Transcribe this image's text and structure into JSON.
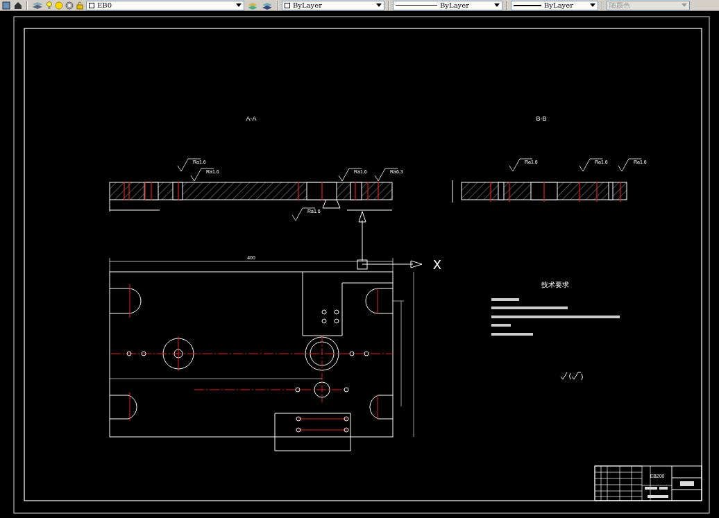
{
  "toolbar": {
    "layer": {
      "name": "EB0"
    },
    "color": {
      "label": "ByLayer"
    },
    "linetype": {
      "label": "ByLayer"
    },
    "lineweight": {
      "label": "ByLayer"
    },
    "plot_style": {
      "label": "随颜色",
      "disabled": true
    }
  },
  "drawing": {
    "section_labels": [
      "A-A",
      "B-B"
    ],
    "surface_finish_labels": [
      "Ra1.6",
      "Ra1.6",
      "Ra1.6",
      "Ra6.3",
      "Ra1.6",
      "Ra1.6",
      "Ra1.6",
      "Ra1.6"
    ],
    "overall_length": "400",
    "axis_label": "X",
    "notes_title": "技术要求",
    "title_block": {
      "code": "EB200"
    }
  }
}
